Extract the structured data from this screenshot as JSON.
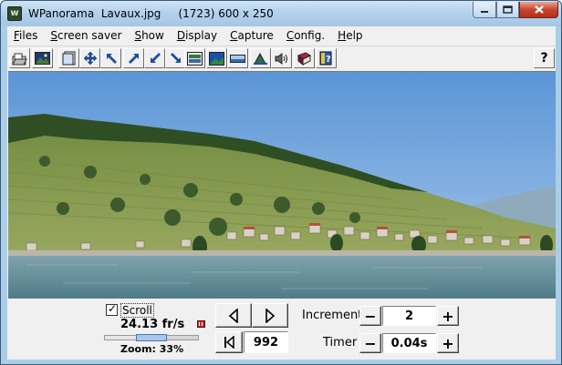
{
  "window": {
    "app_name": "WPanorama",
    "file_name": "Lavaux.jpg",
    "image_info": "(1723) 600 x 250",
    "title": "WPanorama  Lavaux.jpg     (1723) 600 x 250",
    "app_icon_letter": "w"
  },
  "menu": [
    {
      "label": "Files",
      "accel": "F",
      "rest": "iles"
    },
    {
      "label": "Screen saver",
      "accel": "S",
      "rest": "creen saver"
    },
    {
      "label": "Show",
      "accel": "S",
      "rest": "how"
    },
    {
      "label": "Display",
      "accel": "D",
      "rest": "isplay"
    },
    {
      "label": "Capture",
      "accel": "C",
      "rest": "apture"
    },
    {
      "label": "Config.",
      "accel": "C",
      "rest": "onfig."
    },
    {
      "label": "Help",
      "accel": "H",
      "rest": "elp"
    }
  ],
  "toolbar": {
    "buttons": [
      "open-icon",
      "picture-icon",
      "page-icon",
      "move-icon",
      "arrow-nw-icon",
      "arrow-ne-icon",
      "arrow-sw-icon",
      "arrow-se-icon",
      "display-box-icon",
      "landscape-icon",
      "flat-icon",
      "mountain-icon",
      "sound-icon",
      "book-icon",
      "help-book-icon"
    ],
    "help_label": "?"
  },
  "controls": {
    "scroll_checked": true,
    "scroll_label": "Scroll",
    "check_mark": "✓",
    "fps": "24.13 fr/s",
    "zoom_label": "Zoom: 33%",
    "zoom_fraction": 0.33,
    "position_value": "992",
    "increment_label": "Increment",
    "increment_value": "2",
    "timer_label": "Timer",
    "timer_value": "0.04s",
    "minus": "−",
    "plus": "+"
  },
  "colors": {
    "title_bar": "#b4d2ec",
    "client_bg": "#f0f0f0",
    "close_button": "#c9452f",
    "zoom_thumb": "#a7c7ec"
  }
}
